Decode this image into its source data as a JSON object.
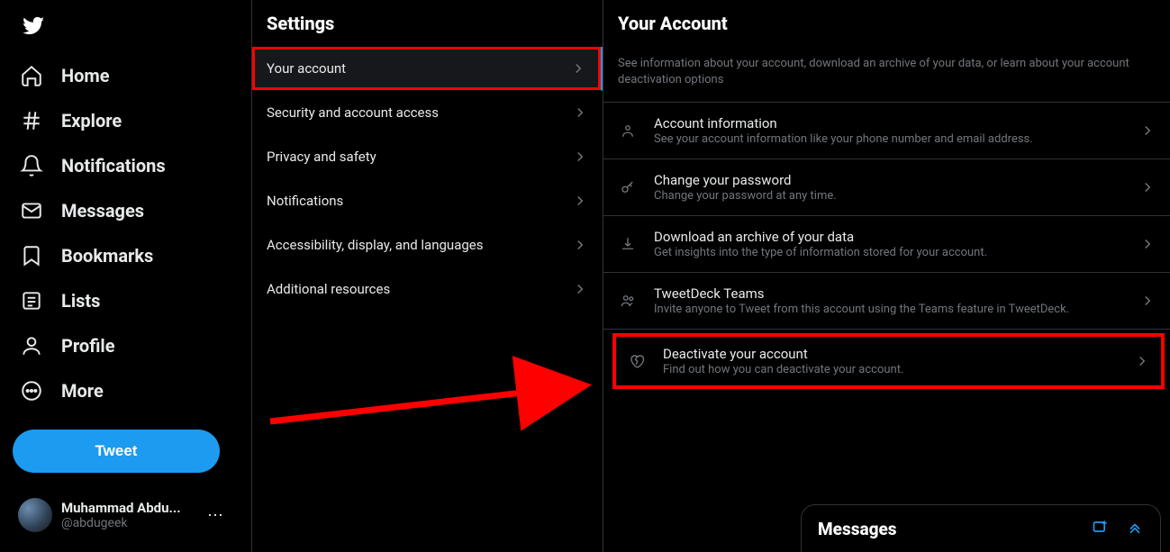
{
  "sidebar": {
    "nav": [
      {
        "label": "Home"
      },
      {
        "label": "Explore"
      },
      {
        "label": "Notifications"
      },
      {
        "label": "Messages"
      },
      {
        "label": "Bookmarks"
      },
      {
        "label": "Lists"
      },
      {
        "label": "Profile"
      },
      {
        "label": "More"
      }
    ],
    "tweet_button": "Tweet",
    "profile": {
      "name": "Muhammad Abdu...",
      "handle": "@abdugeek"
    }
  },
  "settings": {
    "header": "Settings",
    "items": [
      {
        "label": "Your account"
      },
      {
        "label": "Security and account access"
      },
      {
        "label": "Privacy and safety"
      },
      {
        "label": "Notifications"
      },
      {
        "label": "Accessibility, display, and languages"
      },
      {
        "label": "Additional resources"
      }
    ]
  },
  "account": {
    "header": "Your Account",
    "description": "See information about your account, download an archive of your data, or learn about your account deactivation options",
    "items": [
      {
        "title": "Account information",
        "sub": "See your account information like your phone number and email address."
      },
      {
        "title": "Change your password",
        "sub": "Change your password at any time."
      },
      {
        "title": "Download an archive of your data",
        "sub": "Get insights into the type of information stored for your account."
      },
      {
        "title": "TweetDeck Teams",
        "sub": "Invite anyone to Tweet from this account using the Teams feature in TweetDeck."
      },
      {
        "title": "Deactivate your account",
        "sub": "Find out how you can deactivate your account."
      }
    ]
  },
  "messages_bar": {
    "title": "Messages"
  }
}
